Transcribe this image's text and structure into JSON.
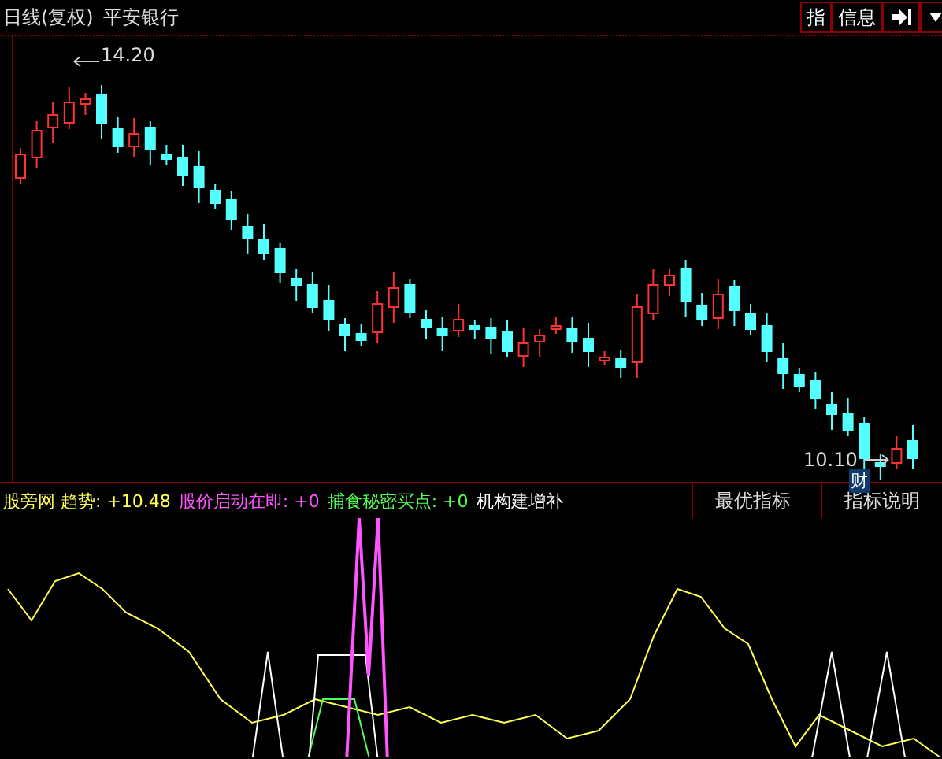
{
  "window": {
    "title": "日线(复权)",
    "stock_name": "平安银行"
  },
  "toolbar": {
    "buttons": [
      {
        "label": "指"
      },
      {
        "label": "信息"
      }
    ]
  },
  "price_chart": {
    "high_label": "14.20",
    "low_label": "10.10",
    "event_marker": "财"
  },
  "indicator": {
    "legend": [
      {
        "text": "股旁网 趋势: +10.48",
        "color": "#ffff54"
      },
      {
        "text": "股价启动在即: +0",
        "color": "#ff54ff"
      },
      {
        "text": "捕食秘密买点: +0",
        "color": "#54ff54"
      },
      {
        "text": "机构建增补",
        "color": "#ffffff"
      }
    ],
    "buttons": [
      "最优指标",
      "指标说明"
    ]
  }
}
